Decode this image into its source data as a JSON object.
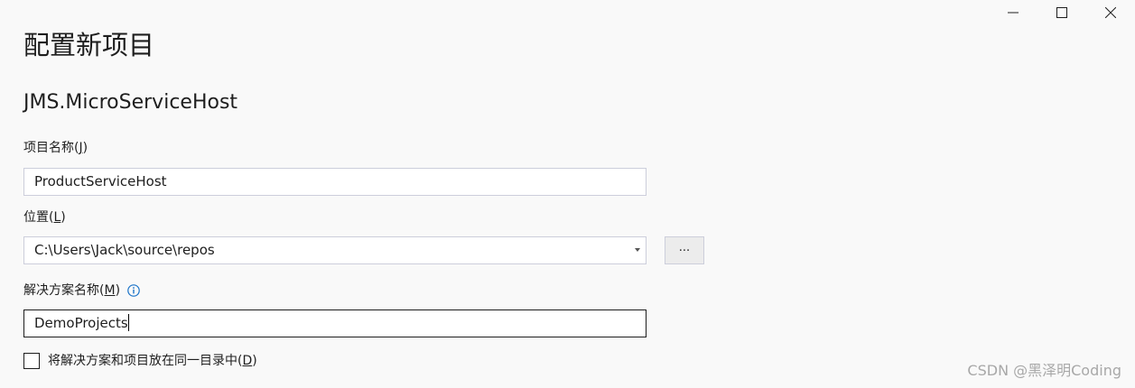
{
  "window": {
    "controls": {
      "minimize_icon": "minimize-icon",
      "maximize_icon": "maximize-icon",
      "close_icon": "close-icon"
    }
  },
  "header": {
    "title": "配置新项目",
    "template_name": "JMS.MicroServiceHost"
  },
  "project_name": {
    "label": "项目名称(",
    "accelerator": "J",
    "label_end": ")",
    "value": "ProductServiceHost"
  },
  "location": {
    "label": "位置(",
    "accelerator": "L",
    "label_end": ")",
    "value": "C:\\Users\\Jack\\source\\repos",
    "browse_label": "..."
  },
  "solution_name": {
    "label": "解决方案名称(",
    "accelerator": "M",
    "label_end": ")",
    "value": "DemoProjects",
    "info_icon": "info-icon"
  },
  "same_directory": {
    "label": "将解决方案和项目放在同一目录中(",
    "accelerator": "D",
    "label_end": ")",
    "checked": false
  },
  "watermark": "CSDN @黑泽明Coding",
  "colors": {
    "accent": "#1a73c8",
    "border": "#cccedb",
    "background": "#f9f9f9"
  }
}
